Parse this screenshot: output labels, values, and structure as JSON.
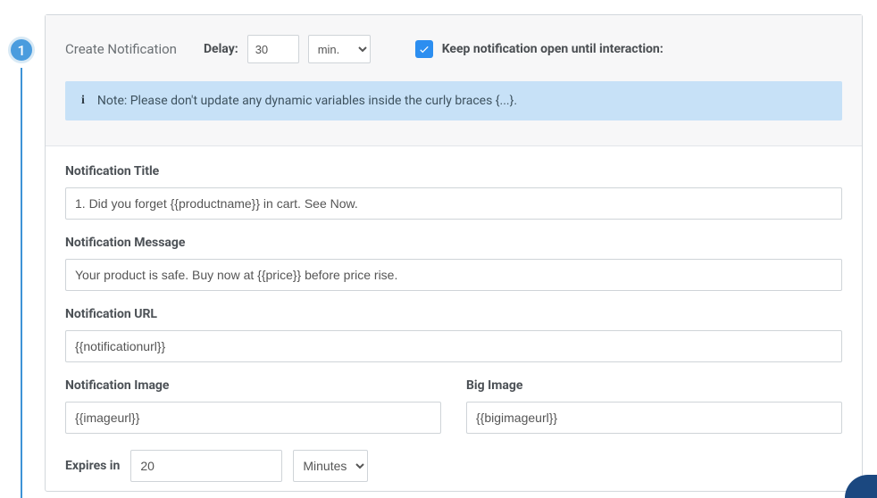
{
  "step": {
    "number": "1"
  },
  "header": {
    "title": "Create Notification",
    "delay_label": "Delay:",
    "delay_value": "30",
    "delay_unit_selected": "min.",
    "keep_open_checked": true,
    "keep_open_label": "Keep notification open until interaction:"
  },
  "note": {
    "text": "Note: Please don't update any dynamic variables inside the curly braces {...}."
  },
  "fields": {
    "title_label": "Notification Title",
    "title_value": "1. Did you forget {{productname}} in cart. See Now.",
    "message_label": "Notification Message",
    "message_value": "Your product is safe. Buy now at {{price}} before price rise.",
    "url_label": "Notification URL",
    "url_value": "{{notificationurl}}",
    "image_label": "Notification Image",
    "image_value": "{{imageurl}}",
    "bigimage_label": "Big Image",
    "bigimage_value": "{{bigimageurl}}",
    "expires_label": "Expires in",
    "expires_value": "20",
    "expires_unit_selected": "Minutes"
  }
}
